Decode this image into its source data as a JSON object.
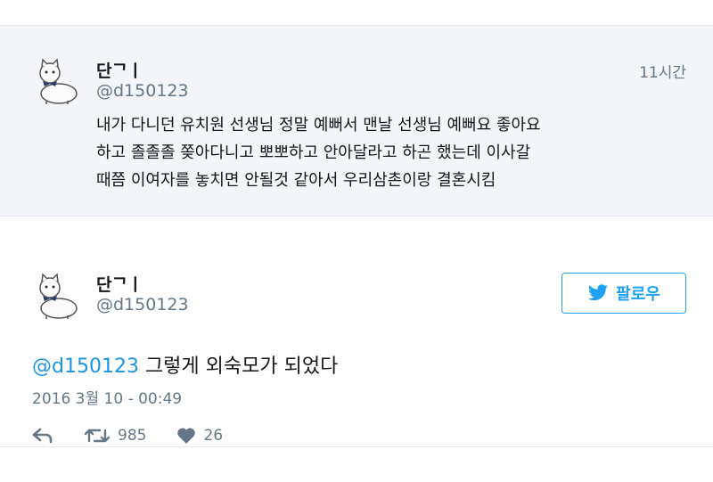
{
  "reply": {
    "name": "단ᄀㅣ",
    "handle": "@d150123",
    "time": "11시간",
    "text_lines": [
      "내가 다니던 유치원 선생님 정말 예뻐서 맨날 선생님 예뻐요 좋아요",
      "하고 졸졸졸 쫒아다니고 뽀뽀하고 안아달라고 하곤 했는데 이사갈",
      "때쯤 이여자를 놓치면 안될것 같아서 우리삼촌이랑 결혼시킴"
    ]
  },
  "main": {
    "name": "단ᄀㅣ",
    "handle": "@d150123",
    "follow_label": "팔로우",
    "mention": "@d150123",
    "text": " 그렇게 외숙모가 되었다",
    "date": "2016 3월 10 - 00:49",
    "retweets": "985",
    "likes": "26"
  },
  "icons": {
    "avatar": "cat-avatar-icon",
    "follow": "bird-icon",
    "reply": "reply-icon",
    "retweet": "retweet-icon",
    "like": "heart-icon"
  },
  "colors": {
    "accent": "#1da1f2",
    "mention": "#1b95e0",
    "muted": "#657786",
    "reply_bg": "#f3f5f8"
  }
}
